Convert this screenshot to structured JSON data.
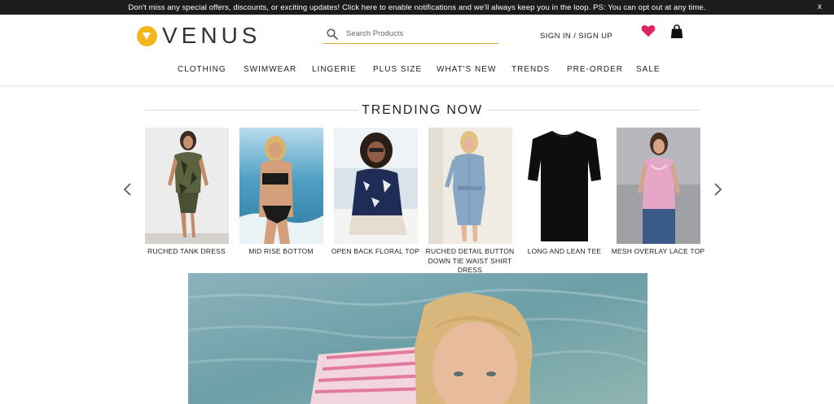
{
  "notification": {
    "text": "Don't miss any special offers, discounts, or exciting updates! Click here to enable notifications and we'll always keep you in the loop. PS: You can opt out at any time.",
    "close_label": "x"
  },
  "header": {
    "logo_text": "VENUS",
    "search_placeholder": "Search Products",
    "signin_label": "SIGN IN / SIGN UP"
  },
  "nav": {
    "items": [
      "CLOTHING",
      "SWIMWEAR",
      "LINGERIE",
      "PLUS SIZE",
      "WHAT'S NEW",
      "TRENDS",
      "PRE-ORDER",
      "SALE"
    ]
  },
  "trending": {
    "title": "TRENDING NOW",
    "products": [
      {
        "name": "RUCHED TANK DRESS"
      },
      {
        "name": "MID RISE BOTTOM"
      },
      {
        "name": "OPEN BACK FLORAL TOP"
      },
      {
        "name": "RUCHED DETAIL BUTTON DOWN TIE WAIST SHIRT DRESS"
      },
      {
        "name": "LONG AND LEAN TEE"
      },
      {
        "name": "MESH OVERLAY LACE TOP"
      }
    ]
  },
  "colors": {
    "logo_accent": "#f5b51b",
    "search_underline": "#e8a93a",
    "heart": "#e0245e",
    "notif_bg": "#1c1c1c"
  },
  "icons": [
    "search-icon",
    "heart-icon",
    "shopping-bag-icon",
    "chevron-left-icon",
    "chevron-right-icon",
    "close-icon"
  ]
}
